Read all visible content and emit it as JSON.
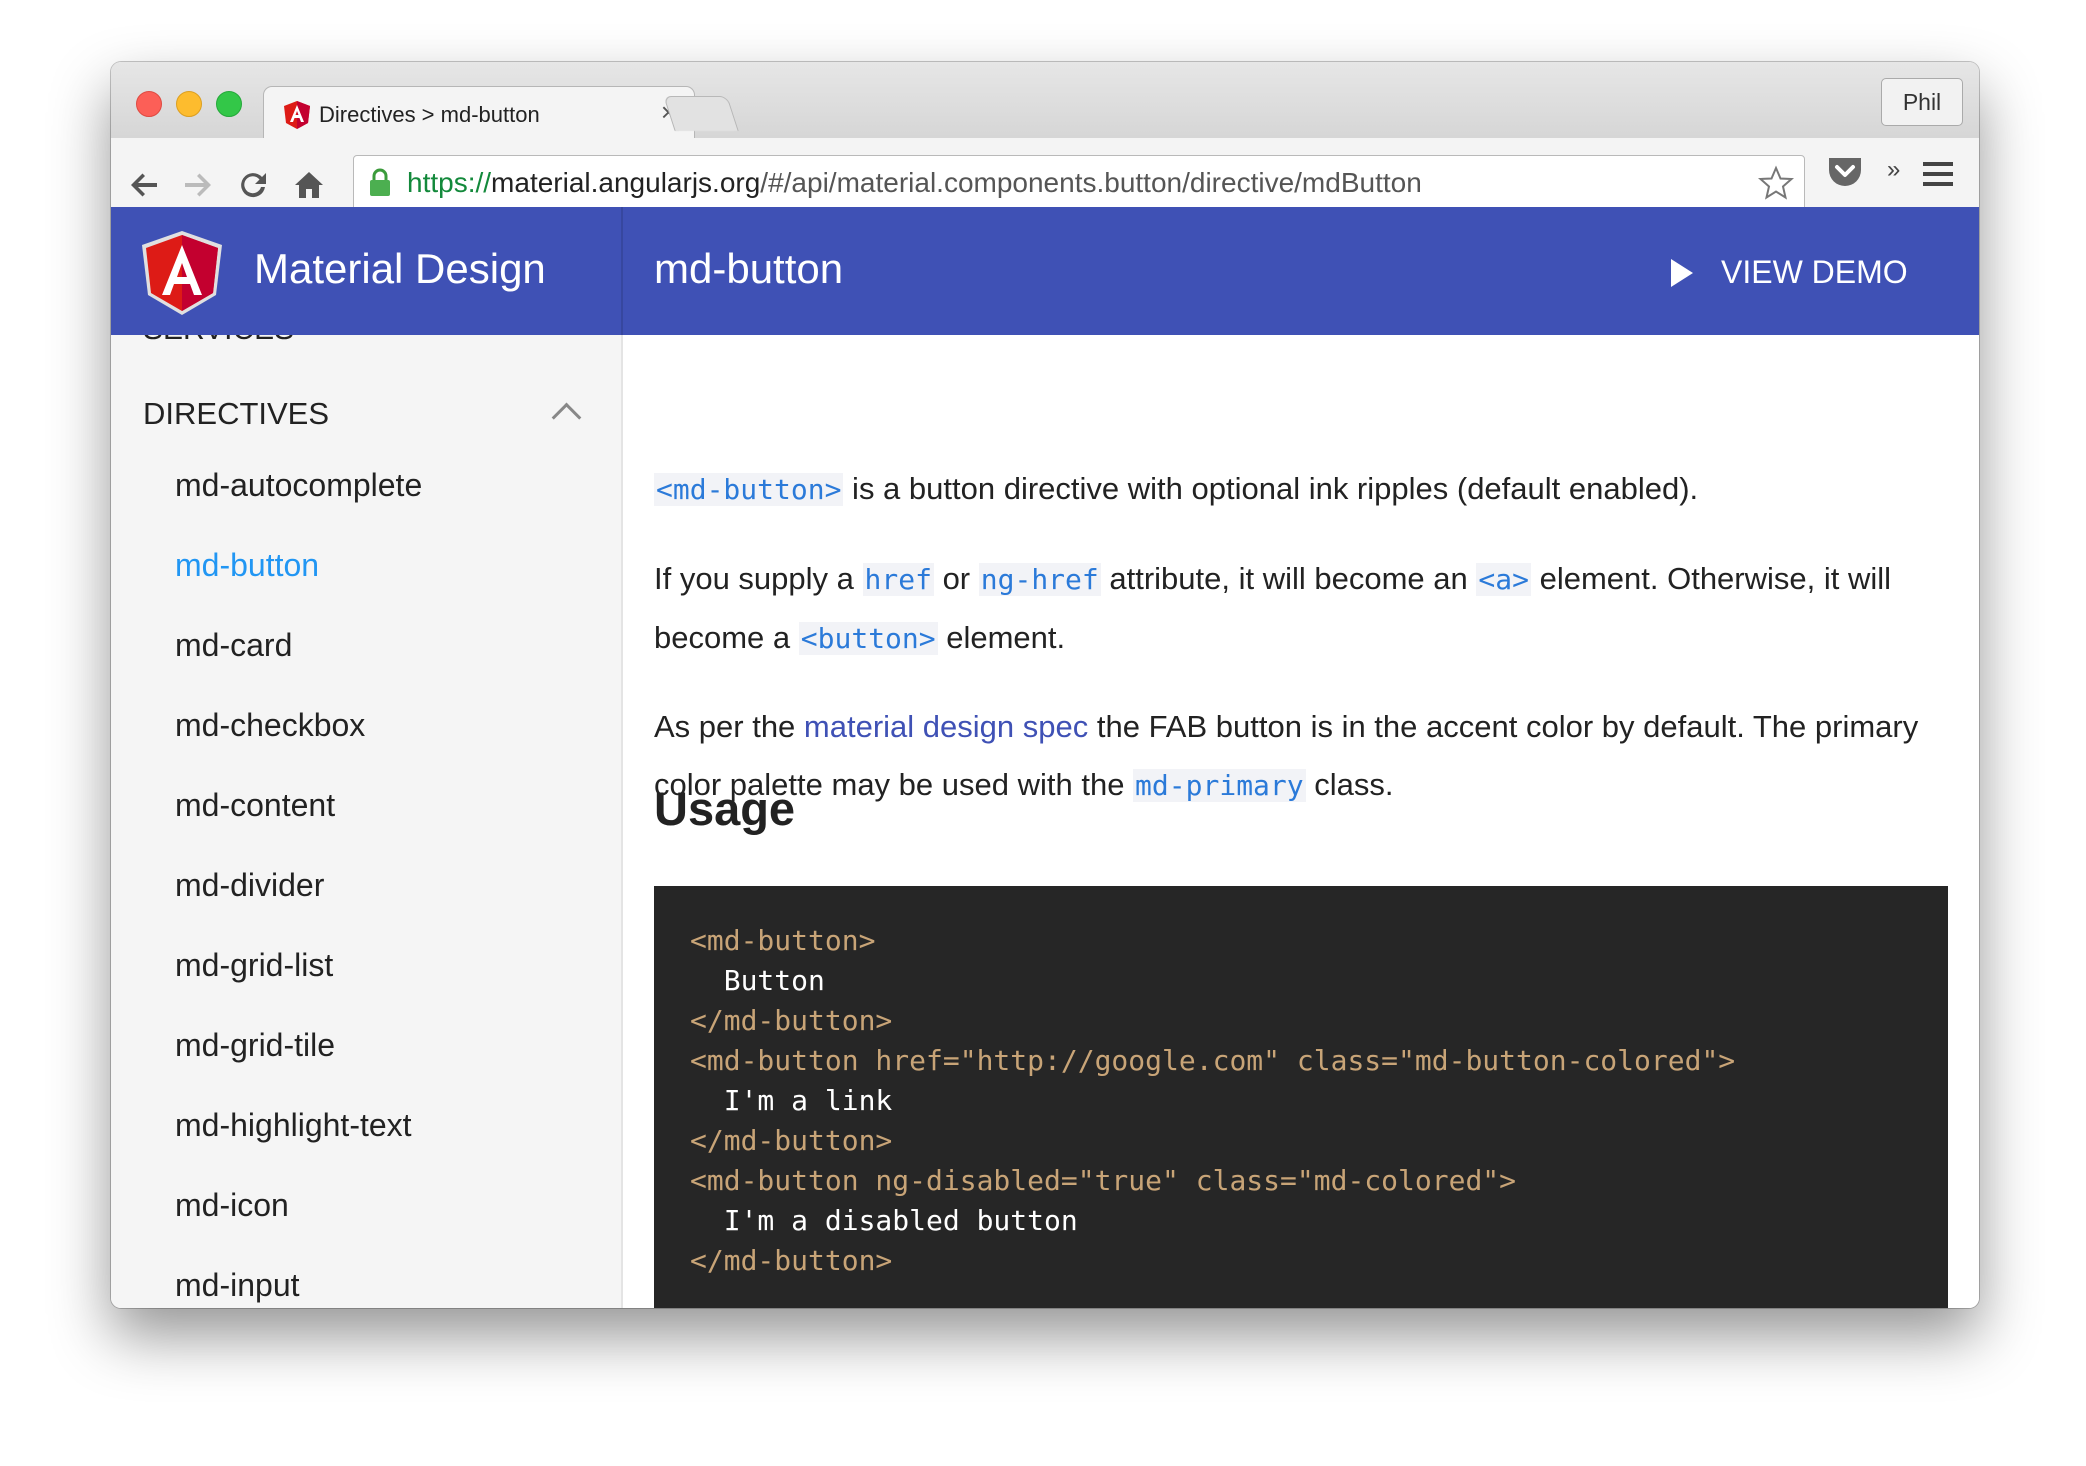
{
  "browser": {
    "tab_title": "Directives > md-button",
    "tab_close": "×",
    "profile_name": "Phil",
    "url_protocol": "https://",
    "url_host": "material.angularjs.org",
    "url_path": "/#/api/material.components.button/directive/mdButton",
    "overflow": "»"
  },
  "header": {
    "brand": "Material Design",
    "title": "md-button",
    "demo_button": "VIEW DEMO"
  },
  "sidebar": {
    "cut_off_label": "SERVICES",
    "section_title": "DIRECTIVES",
    "items": [
      {
        "label": "md-autocomplete"
      },
      {
        "label": "md-button"
      },
      {
        "label": "md-card"
      },
      {
        "label": "md-checkbox"
      },
      {
        "label": "md-content"
      },
      {
        "label": "md-divider"
      },
      {
        "label": "md-grid-list"
      },
      {
        "label": "md-grid-tile"
      },
      {
        "label": "md-highlight-text"
      },
      {
        "label": "md-icon"
      },
      {
        "label": "md-input"
      }
    ],
    "active_item": "md-button"
  },
  "content": {
    "p1": {
      "code": "<md-button>",
      "text": " is a button directive with optional ink ripples (default enabled)."
    },
    "p2": {
      "t1": "If you supply a ",
      "c1": "href",
      "t2": " or ",
      "c2": "ng-href",
      "t3": " attribute, it will become an ",
      "c3": "<a>",
      "t4": " element. Otherwise, it will become a ",
      "c4": "<button>",
      "t5": " element."
    },
    "p3": {
      "t1": "As per the ",
      "link": "material design spec",
      "t2": " the FAB button is in the accent color by default. The primary color palette may be used with the ",
      "code": "md-primary",
      "t3": " class."
    },
    "usage_heading": "Usage",
    "code_lines": [
      {
        "kind": "tag",
        "text": "<md-button>"
      },
      {
        "kind": "txt",
        "text": "  Button"
      },
      {
        "kind": "tag",
        "text": "</md-button>"
      },
      {
        "kind": "tag",
        "text": "<md-button href=\"http://google.com\" class=\"md-button-colored\">"
      },
      {
        "kind": "txt",
        "text": "  I'm a link"
      },
      {
        "kind": "tag",
        "text": "</md-button>"
      },
      {
        "kind": "tag",
        "text": "<md-button ng-disabled=\"true\" class=\"md-colored\">"
      },
      {
        "kind": "txt",
        "text": "  I'm a disabled button"
      },
      {
        "kind": "tag",
        "text": "</md-button>"
      }
    ]
  },
  "colors": {
    "appbar": "#3f51b5",
    "active_nav": "#2196f3",
    "code_bg": "#262626",
    "code_tag": "#c8a477"
  },
  "icons": [
    "close-icon",
    "back-icon",
    "forward-icon",
    "reload-icon",
    "home-icon",
    "lock-icon",
    "star-icon",
    "pocket-icon",
    "menu-icon",
    "angular-logo-icon",
    "play-icon",
    "chevron-up-icon"
  ]
}
